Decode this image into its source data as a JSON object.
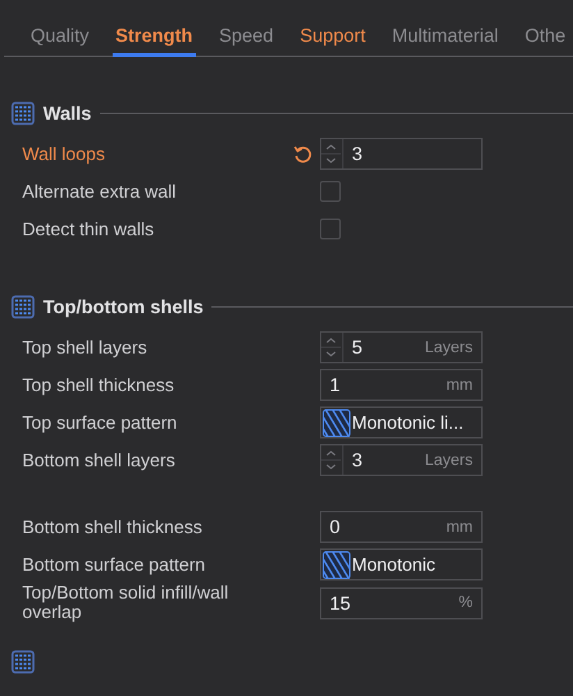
{
  "tabs": [
    {
      "label": "Quality",
      "selected": false,
      "modified": false
    },
    {
      "label": "Strength",
      "selected": true,
      "modified": true
    },
    {
      "label": "Speed",
      "selected": false,
      "modified": false
    },
    {
      "label": "Support",
      "selected": false,
      "modified": true
    },
    {
      "label": "Multimaterial",
      "selected": false,
      "modified": false
    },
    {
      "label": "Othe",
      "selected": false,
      "modified": false
    }
  ],
  "sections": [
    {
      "title": "Walls",
      "rows": [
        {
          "kind": "spin",
          "label": "Wall loops",
          "modified": true,
          "value": "3"
        },
        {
          "kind": "checkbox",
          "label": "Alternate extra wall",
          "modified": false,
          "checked": false
        },
        {
          "kind": "checkbox",
          "label": "Detect thin walls",
          "modified": false,
          "checked": false
        }
      ]
    },
    {
      "title": "Top/bottom shells",
      "rows": [
        {
          "kind": "spin",
          "label": "Top shell layers",
          "modified": false,
          "value": "5",
          "unit": "Layers"
        },
        {
          "kind": "number",
          "label": "Top shell thickness",
          "modified": false,
          "value": "1",
          "unit": "mm"
        },
        {
          "kind": "pattern",
          "label": "Top surface pattern",
          "modified": false,
          "value": "Monotonic li..."
        },
        {
          "kind": "spin",
          "label": "Bottom shell layers",
          "modified": false,
          "value": "3",
          "unit": "Layers"
        },
        {
          "kind": "number",
          "label": "Bottom shell thickness",
          "modified": false,
          "value": "0",
          "unit": "mm"
        },
        {
          "kind": "pattern",
          "label": "Bottom surface pattern",
          "modified": false,
          "value": "Monotonic"
        },
        {
          "kind": "number",
          "label": "Top/Bottom solid infill/wall overlap",
          "modified": false,
          "value": "15",
          "unit": "%"
        }
      ]
    }
  ]
}
